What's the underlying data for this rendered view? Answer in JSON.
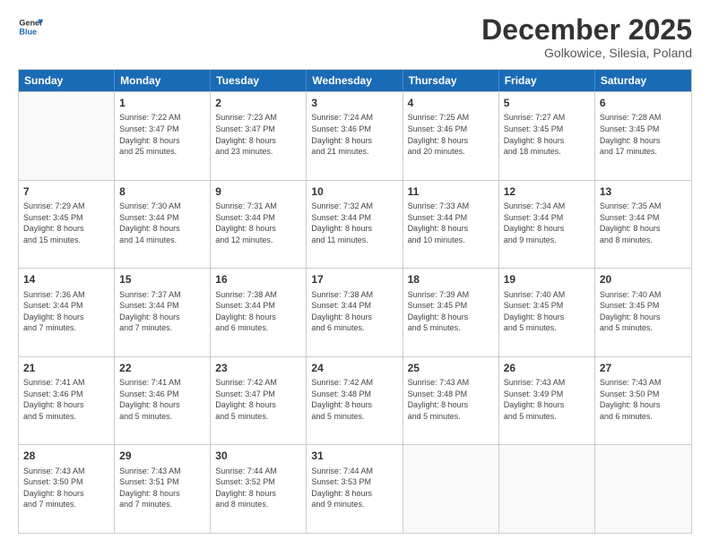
{
  "header": {
    "logo_line1": "General",
    "logo_line2": "Blue",
    "month_title": "December 2025",
    "location": "Golkowice, Silesia, Poland"
  },
  "days_of_week": [
    "Sunday",
    "Monday",
    "Tuesday",
    "Wednesday",
    "Thursday",
    "Friday",
    "Saturday"
  ],
  "weeks": [
    [
      {
        "day": "",
        "info": ""
      },
      {
        "day": "1",
        "info": "Sunrise: 7:22 AM\nSunset: 3:47 PM\nDaylight: 8 hours\nand 25 minutes."
      },
      {
        "day": "2",
        "info": "Sunrise: 7:23 AM\nSunset: 3:47 PM\nDaylight: 8 hours\nand 23 minutes."
      },
      {
        "day": "3",
        "info": "Sunrise: 7:24 AM\nSunset: 3:46 PM\nDaylight: 8 hours\nand 21 minutes."
      },
      {
        "day": "4",
        "info": "Sunrise: 7:25 AM\nSunset: 3:46 PM\nDaylight: 8 hours\nand 20 minutes."
      },
      {
        "day": "5",
        "info": "Sunrise: 7:27 AM\nSunset: 3:45 PM\nDaylight: 8 hours\nand 18 minutes."
      },
      {
        "day": "6",
        "info": "Sunrise: 7:28 AM\nSunset: 3:45 PM\nDaylight: 8 hours\nand 17 minutes."
      }
    ],
    [
      {
        "day": "7",
        "info": "Sunrise: 7:29 AM\nSunset: 3:45 PM\nDaylight: 8 hours\nand 15 minutes."
      },
      {
        "day": "8",
        "info": "Sunrise: 7:30 AM\nSunset: 3:44 PM\nDaylight: 8 hours\nand 14 minutes."
      },
      {
        "day": "9",
        "info": "Sunrise: 7:31 AM\nSunset: 3:44 PM\nDaylight: 8 hours\nand 12 minutes."
      },
      {
        "day": "10",
        "info": "Sunrise: 7:32 AM\nSunset: 3:44 PM\nDaylight: 8 hours\nand 11 minutes."
      },
      {
        "day": "11",
        "info": "Sunrise: 7:33 AM\nSunset: 3:44 PM\nDaylight: 8 hours\nand 10 minutes."
      },
      {
        "day": "12",
        "info": "Sunrise: 7:34 AM\nSunset: 3:44 PM\nDaylight: 8 hours\nand 9 minutes."
      },
      {
        "day": "13",
        "info": "Sunrise: 7:35 AM\nSunset: 3:44 PM\nDaylight: 8 hours\nand 8 minutes."
      }
    ],
    [
      {
        "day": "14",
        "info": "Sunrise: 7:36 AM\nSunset: 3:44 PM\nDaylight: 8 hours\nand 7 minutes."
      },
      {
        "day": "15",
        "info": "Sunrise: 7:37 AM\nSunset: 3:44 PM\nDaylight: 8 hours\nand 7 minutes."
      },
      {
        "day": "16",
        "info": "Sunrise: 7:38 AM\nSunset: 3:44 PM\nDaylight: 8 hours\nand 6 minutes."
      },
      {
        "day": "17",
        "info": "Sunrise: 7:38 AM\nSunset: 3:44 PM\nDaylight: 8 hours\nand 6 minutes."
      },
      {
        "day": "18",
        "info": "Sunrise: 7:39 AM\nSunset: 3:45 PM\nDaylight: 8 hours\nand 5 minutes."
      },
      {
        "day": "19",
        "info": "Sunrise: 7:40 AM\nSunset: 3:45 PM\nDaylight: 8 hours\nand 5 minutes."
      },
      {
        "day": "20",
        "info": "Sunrise: 7:40 AM\nSunset: 3:45 PM\nDaylight: 8 hours\nand 5 minutes."
      }
    ],
    [
      {
        "day": "21",
        "info": "Sunrise: 7:41 AM\nSunset: 3:46 PM\nDaylight: 8 hours\nand 5 minutes."
      },
      {
        "day": "22",
        "info": "Sunrise: 7:41 AM\nSunset: 3:46 PM\nDaylight: 8 hours\nand 5 minutes."
      },
      {
        "day": "23",
        "info": "Sunrise: 7:42 AM\nSunset: 3:47 PM\nDaylight: 8 hours\nand 5 minutes."
      },
      {
        "day": "24",
        "info": "Sunrise: 7:42 AM\nSunset: 3:48 PM\nDaylight: 8 hours\nand 5 minutes."
      },
      {
        "day": "25",
        "info": "Sunrise: 7:43 AM\nSunset: 3:48 PM\nDaylight: 8 hours\nand 5 minutes."
      },
      {
        "day": "26",
        "info": "Sunrise: 7:43 AM\nSunset: 3:49 PM\nDaylight: 8 hours\nand 5 minutes."
      },
      {
        "day": "27",
        "info": "Sunrise: 7:43 AM\nSunset: 3:50 PM\nDaylight: 8 hours\nand 6 minutes."
      }
    ],
    [
      {
        "day": "28",
        "info": "Sunrise: 7:43 AM\nSunset: 3:50 PM\nDaylight: 8 hours\nand 7 minutes."
      },
      {
        "day": "29",
        "info": "Sunrise: 7:43 AM\nSunset: 3:51 PM\nDaylight: 8 hours\nand 7 minutes."
      },
      {
        "day": "30",
        "info": "Sunrise: 7:44 AM\nSunset: 3:52 PM\nDaylight: 8 hours\nand 8 minutes."
      },
      {
        "day": "31",
        "info": "Sunrise: 7:44 AM\nSunset: 3:53 PM\nDaylight: 8 hours\nand 9 minutes."
      },
      {
        "day": "",
        "info": ""
      },
      {
        "day": "",
        "info": ""
      },
      {
        "day": "",
        "info": ""
      }
    ]
  ]
}
